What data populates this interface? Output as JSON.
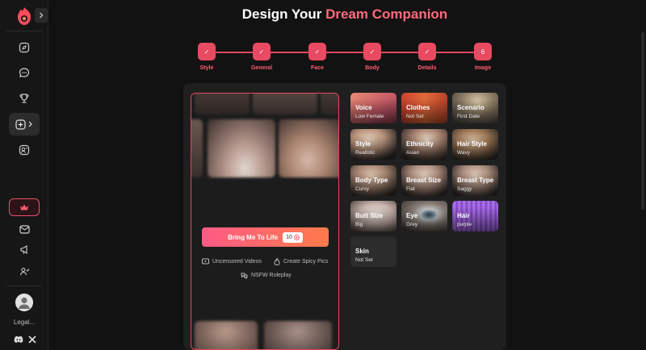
{
  "header": {
    "title_prefix": "Design Your ",
    "title_accent": "Dream Companion"
  },
  "steps": [
    {
      "label": "Style",
      "mark": "✓"
    },
    {
      "label": "General",
      "mark": "✓"
    },
    {
      "label": "Face",
      "mark": "✓"
    },
    {
      "label": "Body",
      "mark": "✓"
    },
    {
      "label": "Details",
      "mark": "✓"
    },
    {
      "label": "Image",
      "mark": "6"
    }
  ],
  "sidebar": {
    "icons": [
      "compass-icon",
      "chat-icon",
      "trophy-icon",
      "create-icon",
      "profile-badge-icon",
      "crown-icon",
      "mail-icon",
      "megaphone-icon",
      "users-icon"
    ],
    "legal_label": "Legal...",
    "social": [
      "discord-icon",
      "x-icon"
    ]
  },
  "preview": {
    "cta_label": "Bring Me To Life",
    "cta_cost": "10",
    "features": [
      "Uncensored Videos",
      "Create Spicy Pics",
      "NSFW Roleplay"
    ]
  },
  "options": [
    {
      "title": "Voice",
      "value": "Low Female"
    },
    {
      "title": "Clothes",
      "value": "Not Set"
    },
    {
      "title": "Scenario",
      "value": "First Date"
    },
    {
      "title": "Style",
      "value": "Realistic"
    },
    {
      "title": "Ethnicity",
      "value": "Asian"
    },
    {
      "title": "Hair Style",
      "value": "Wavy"
    },
    {
      "title": "Body Type",
      "value": "Curvy"
    },
    {
      "title": "Breast Size",
      "value": "Flat"
    },
    {
      "title": "Breast Type",
      "value": "Saggy"
    },
    {
      "title": "Butt Size",
      "value": "Big"
    },
    {
      "title": "Eye",
      "value": "Grey"
    },
    {
      "title": "Hair",
      "value": "purple"
    },
    {
      "title": "Skin",
      "value": "Not Set"
    }
  ],
  "colors": {
    "accent": "#e84a62",
    "accent_text": "#ff6b7f",
    "background": "#121212",
    "panel": "#1f1f1f"
  }
}
